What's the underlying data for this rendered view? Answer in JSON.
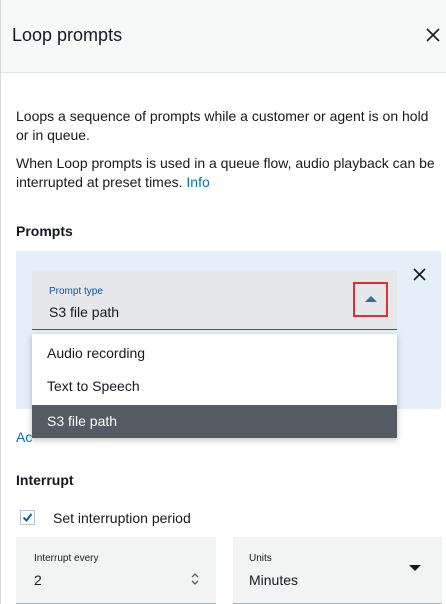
{
  "header": {
    "title": "Loop prompts"
  },
  "description": {
    "line1": "Loops a sequence of prompts while a customer or agent is on hold or in queue.",
    "line2": "When Loop prompts is used in a queue flow, audio playback can be interrupted at preset times.",
    "info_link": "Info"
  },
  "prompts": {
    "heading": "Prompts",
    "select": {
      "label": "Prompt type",
      "value": "S3 file path"
    },
    "options": [
      "Audio recording",
      "Text to Speech",
      "S3 file path"
    ],
    "add_stub": "Ac"
  },
  "interrupt": {
    "heading": "Interrupt",
    "checkbox_label": "Set interruption period",
    "checked": true,
    "every": {
      "label": "Interrupt every",
      "value": "2"
    },
    "units": {
      "label": "Units",
      "value": "Minutes"
    }
  },
  "colors": {
    "accent": "#0073bb",
    "selected_option": "#545b64",
    "highlight_box": "#dd2f36",
    "prompt_area_bg": "#e4eff9"
  }
}
